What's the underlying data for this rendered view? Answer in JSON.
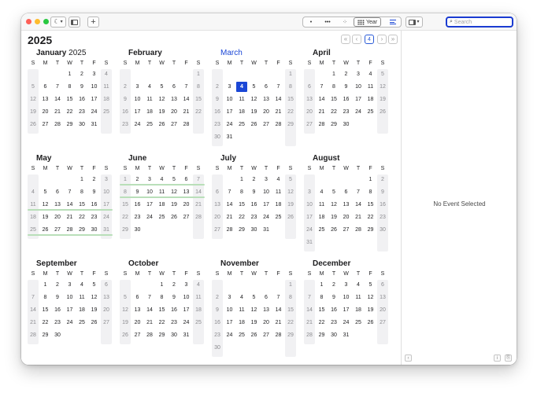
{
  "window": {
    "traffic_lights": [
      "#fe5f57",
      "#febc2e",
      "#28c840"
    ]
  },
  "toolbar": {
    "add_label": "+",
    "view_modes": [
      "•",
      "•••",
      "⁘",
      "Year"
    ],
    "selected_view": "Year",
    "search": {
      "placeholder": "Search"
    }
  },
  "calendar": {
    "year": "2025",
    "nav": {
      "prev_year": "«",
      "prev": "‹",
      "today": "4",
      "next": "›",
      "next_year": "»"
    },
    "weekday_headers": [
      "S",
      "M",
      "T",
      "W",
      "T",
      "F",
      "S"
    ],
    "today": {
      "month": 2,
      "day": 4
    },
    "highlight_color": "#b9dfb9",
    "today_color": "#1b47d6",
    "months": [
      {
        "name": "January",
        "year_suffix": "2025",
        "start": 3,
        "days": 31
      },
      {
        "name": "February",
        "start": 6,
        "days": 28
      },
      {
        "name": "March",
        "start": 6,
        "days": 31,
        "current": true
      },
      {
        "name": "April",
        "start": 2,
        "days": 30
      },
      {
        "name": "May",
        "start": 4,
        "days": 31,
        "highlight_weeks": [
          2,
          4
        ]
      },
      {
        "name": "June",
        "start": 0,
        "days": 30,
        "highlight_weeks": [
          0,
          1
        ]
      },
      {
        "name": "July",
        "start": 2,
        "days": 31
      },
      {
        "name": "August",
        "start": 5,
        "days": 31
      },
      {
        "name": "September",
        "start": 1,
        "days": 30
      },
      {
        "name": "October",
        "start": 3,
        "days": 31
      },
      {
        "name": "November",
        "start": 6,
        "days": 30
      },
      {
        "name": "December",
        "start": 1,
        "days": 31
      }
    ]
  },
  "sidebar": {
    "no_event_text": "No Event Selected"
  }
}
